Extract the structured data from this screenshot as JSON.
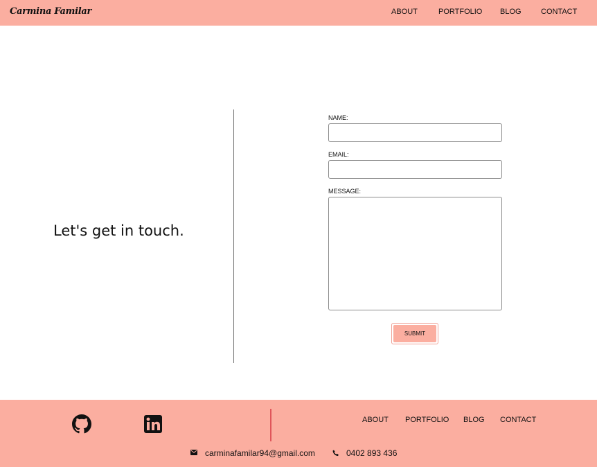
{
  "header": {
    "brand": "Carmina Familar",
    "nav": [
      "ABOUT",
      "PORTFOLIO",
      "BLOG",
      "CONTACT"
    ]
  },
  "main": {
    "headline": "Let's get in touch.",
    "form": {
      "name_label": "NAME:",
      "name_value": "",
      "email_label": "EMAIL:",
      "email_value": "",
      "message_label": "MESSAGE:",
      "message_value": "",
      "submit_label": "SUBMIT"
    }
  },
  "footer": {
    "social_icons": [
      "github-icon",
      "linkedin-icon"
    ],
    "nav": [
      "ABOUT",
      "PORTFOLIO",
      "BLOG",
      "CONTACT"
    ],
    "email": "carminafamilar94@gmail.com",
    "phone": "0402 893 436",
    "contact_icons": [
      "envelope-icon",
      "phone-icon"
    ]
  },
  "colors": {
    "accent": "#fbaea0",
    "divider_accent": "#e0565a",
    "text": "#111111",
    "background": "#ffffff"
  }
}
